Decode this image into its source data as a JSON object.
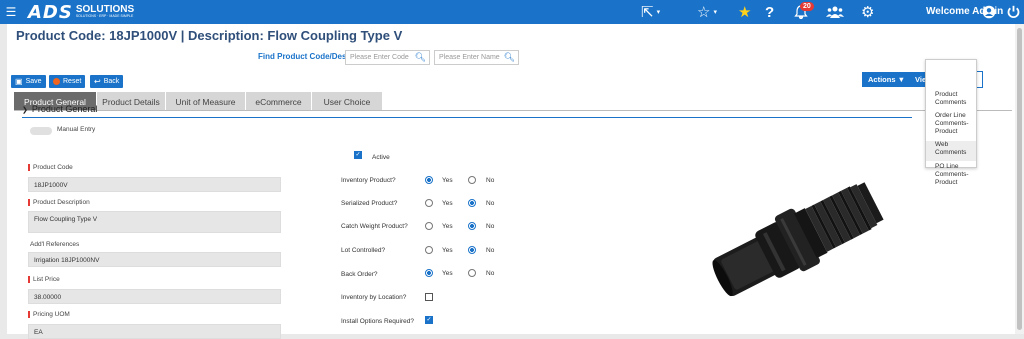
{
  "topbar": {
    "menu_icon": "menu-icon",
    "logo_main": "ADS",
    "logo_word": "SOLUTIONS",
    "logo_tag": "SOLUTIONS · ERP · MADE SIMPLE",
    "notification_count": "20",
    "welcome": "Welcome Admin",
    "icons": [
      "share-icon",
      "star-outline-icon",
      "star-filled-icon",
      "help-icon",
      "bell-icon",
      "users-icon",
      "gear-icon",
      "user-icon",
      "power-icon"
    ]
  },
  "header": {
    "title": "Product Code:  18JP1000V | Description: Flow Coupling Type V",
    "find_label": "Find Product Code/Desc",
    "code_placeholder": "Please Enter Code",
    "name_placeholder": "Please Enter Name"
  },
  "toolbar": {
    "save": "Save",
    "reset": "Reset",
    "back": "Back",
    "actions": "Actions ▼",
    "views": "Views ▼"
  },
  "tabs": [
    "Product General",
    "Product Details",
    "Unit of Measure",
    "eCommerce",
    "User Choice"
  ],
  "section": {
    "title": "Product General"
  },
  "left_fields": {
    "manual_entry": "Manual Entry",
    "product_code_label": "Product Code",
    "product_code": "18JP1000V",
    "description_label": "Product Description",
    "description": "Flow Coupling Type V",
    "refs_label": "Add'l References",
    "refs": "Irrigation 18JP1000NV",
    "list_price_label": "List Price",
    "list_price": "38.00000",
    "pricing_uom_label": "Pricing UOM",
    "pricing_uom": "EA"
  },
  "middle_fields": {
    "active": "Active",
    "inventory": "Inventory Product?",
    "serialized": "Serialized Product?",
    "catch_weight": "Catch Weight Product?",
    "lot_controlled": "Lot Controlled?",
    "back_order": "Back Order?",
    "inv_by_location": "Inventory by Location?",
    "install_options": "Install Options Required?",
    "yes": "Yes",
    "no": "No"
  },
  "views_menu": {
    "items": [
      "Product Comments",
      "Order Line Comments-Product",
      "Web Comments",
      "PO Line Comments-Product"
    ],
    "highlighted": "Web Comments"
  },
  "colors": {
    "brand_blue": "#1a73c9",
    "reset_orange": "#f0641e",
    "required_red": "#e53935"
  }
}
